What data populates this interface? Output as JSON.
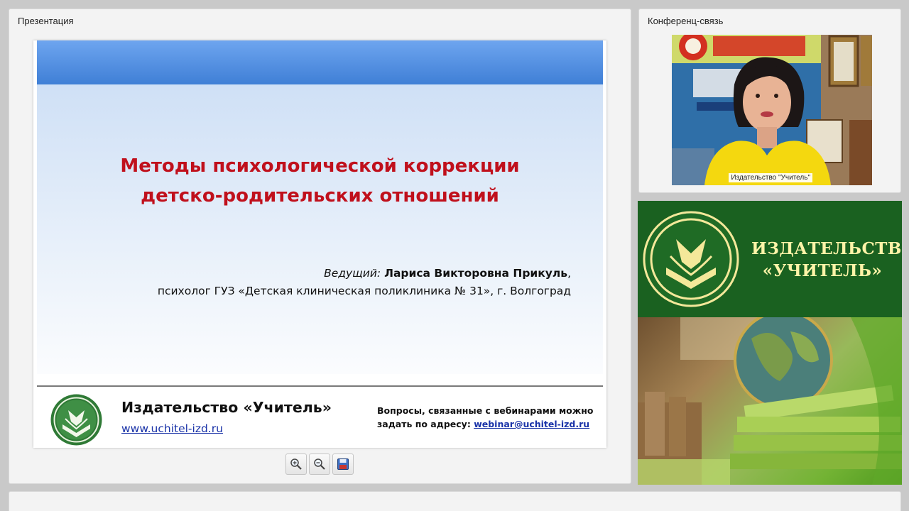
{
  "presentation": {
    "title": "Презентация",
    "slide": {
      "title_line1": "Методы психологической коррекции",
      "title_line2": "детско-родительских отношений",
      "presenter_role": "Ведущий:",
      "presenter_name": "Лариса Викторовна Прикуль",
      "presenter_comma": ",",
      "presenter_position": "психолог ГУЗ «Детская клиническая поликлиника № 31», г. Волгоград",
      "publisher_name": "Издательство «Учитель»",
      "publisher_url": "www.uchitel-izd.ru",
      "contact_line1": "Вопросы, связанные с вебинарами можно",
      "contact_prefix": "задать по адресу:",
      "contact_email": "webinar@uchitel-izd.ru"
    },
    "controls": [
      "zoom-in-icon",
      "zoom-out-icon",
      "save-icon"
    ]
  },
  "conference": {
    "title": "Конференц-связь",
    "video_label": "Издательство \"Учитель\""
  },
  "banner": {
    "line1": "ИЗДАТЕЛЬСТВО",
    "line2": "«УЧИТЕЛЬ»"
  },
  "colors": {
    "slide_title": "#c0101c",
    "link": "#1a33a8",
    "banner_green": "#1a6120",
    "banner_text": "#fff4a8"
  }
}
